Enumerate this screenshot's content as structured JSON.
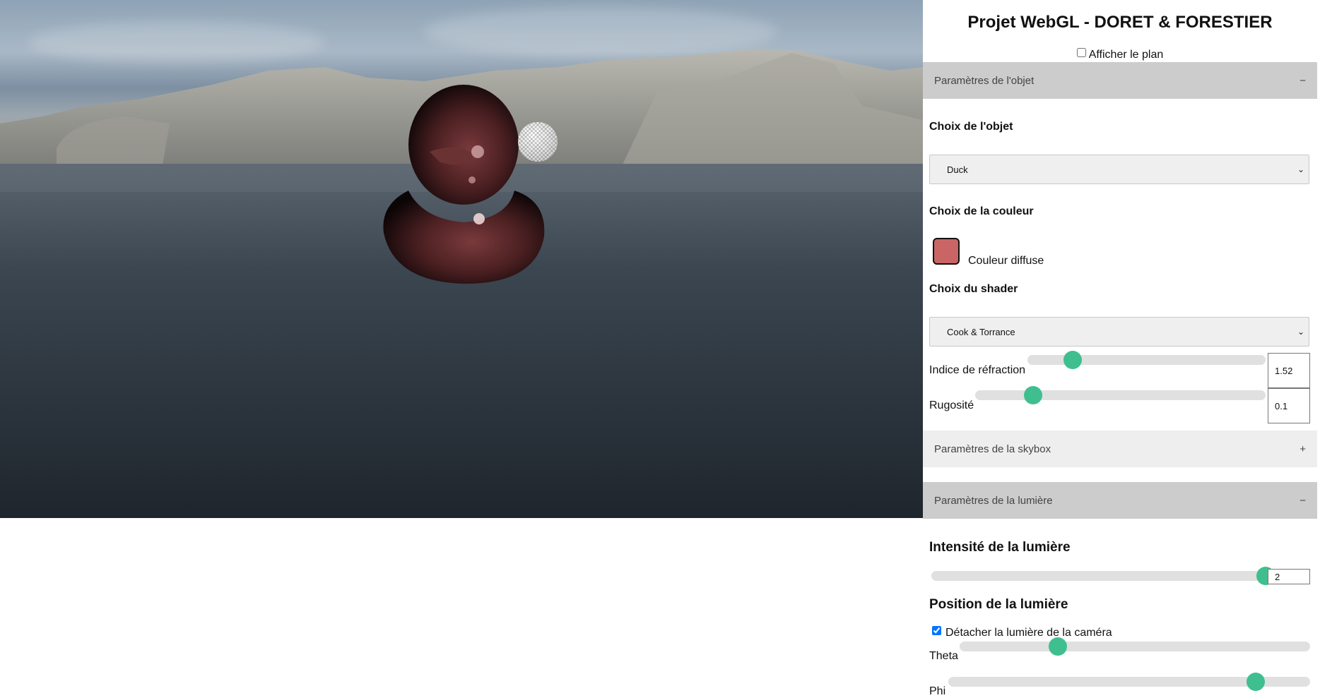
{
  "app": {
    "title": "Projet WebGL - DORET & FORESTIER"
  },
  "plan": {
    "label": "Afficher le plan",
    "checked": false
  },
  "object_section": {
    "header": "Paramètres de l'objet",
    "toggle": "−",
    "object_label": "Choix de l'objet",
    "object_selected": "Duck",
    "color_label": "Choix de la couleur",
    "color_value": "#c96565",
    "color_caption": "Couleur diffuse",
    "shader_label": "Choix du shader",
    "shader_selected": "Cook & Torrance",
    "refraction_label": "Indice de réfraction",
    "refraction_value": "1.52",
    "refraction_fraction": 0.19,
    "roughness_label": "Rugosité",
    "roughness_value": "0.1",
    "roughness_fraction": 0.2
  },
  "skybox_section": {
    "header": "Paramètres de la skybox",
    "toggle": "+"
  },
  "light_section": {
    "header": "Paramètres de la lumière",
    "toggle": "−",
    "intensity_label": "Intensité de la lumière",
    "intensity_value": "2",
    "intensity_fraction": 1.0,
    "position_label": "Position de la lumière",
    "detach_label": "Détacher la lumière de la caméra",
    "detach_checked": true,
    "theta_label": "Theta",
    "theta_fraction": 0.28,
    "phi_label": "Phi",
    "phi_fraction": 0.85
  },
  "scene": {
    "object": "duck",
    "object_color": "#5a2a2c",
    "light_marker": "wireframe-sphere"
  },
  "colors": {
    "accent": "#3fbf8f",
    "open_header": "#cccccc",
    "closed_header": "#eeeeee"
  }
}
